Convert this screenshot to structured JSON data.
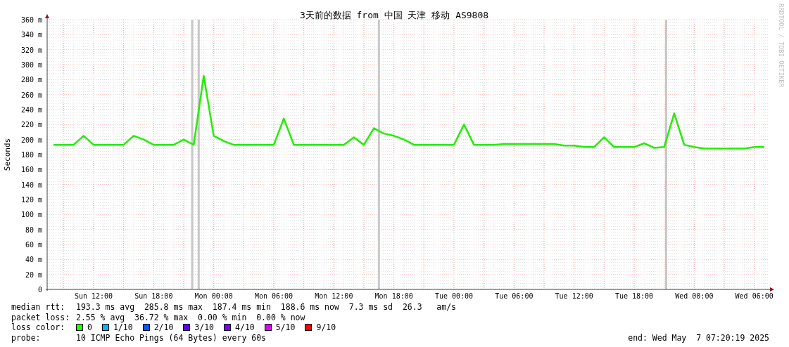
{
  "graph": {
    "credit": "RRDTOOL / TOBI OETIKER",
    "chart_data": {
      "type": "line",
      "title": "3天前的数据 from 中国 天津 移动 AS9808",
      "ylabel": "Seconds",
      "ylim": [
        0,
        360
      ],
      "categories": [
        null,
        null,
        null,
        null,
        "Sun 12:00",
        null,
        null,
        null,
        null,
        null,
        "Sun 18:00",
        null,
        null,
        null,
        null,
        null,
        "Mon 00:00",
        null,
        null,
        null,
        null,
        null,
        "Mon 06:00",
        null,
        null,
        null,
        null,
        null,
        "Mon 12:00",
        null,
        null,
        null,
        null,
        null,
        "Mon 18:00",
        null,
        null,
        null,
        null,
        null,
        "Tue 00:00",
        null,
        null,
        null,
        null,
        null,
        "Tue 06:00",
        null,
        null,
        null,
        null,
        null,
        "Tue 12:00",
        null,
        null,
        null,
        null,
        null,
        "Tue 18:00",
        null,
        null,
        null,
        null,
        null,
        "Wed 00:00",
        null,
        null,
        null,
        null,
        null,
        "Wed 06:00",
        null
      ],
      "yticks": [
        {
          "value": 0,
          "label": "0"
        },
        {
          "value": 20,
          "label": "20 m"
        },
        {
          "value": 40,
          "label": "40 m"
        },
        {
          "value": 60,
          "label": "60 m"
        },
        {
          "value": 80,
          "label": "80 m"
        },
        {
          "value": 100,
          "label": "100 m"
        },
        {
          "value": 120,
          "label": "120 m"
        },
        {
          "value": 140,
          "label": "140 m"
        },
        {
          "value": 160,
          "label": "160 m"
        },
        {
          "value": 180,
          "label": "180 m"
        },
        {
          "value": 200,
          "label": "200 m"
        },
        {
          "value": 220,
          "label": "220 m"
        },
        {
          "value": 240,
          "label": "240 m"
        },
        {
          "value": 260,
          "label": "260 m"
        },
        {
          "value": 280,
          "label": "280 m"
        },
        {
          "value": 300,
          "label": "300 m"
        },
        {
          "value": 320,
          "label": "320 m"
        },
        {
          "value": 340,
          "label": "340 m"
        },
        {
          "value": 360,
          "label": "360 m"
        }
      ],
      "series": [
        {
          "color": "#22ee00",
          "values": [
            193,
            193,
            193,
            205,
            193,
            193,
            193,
            193,
            205,
            200,
            193,
            193,
            193,
            200,
            193,
            285,
            205,
            198,
            193,
            193,
            193,
            193,
            193,
            228,
            193,
            193,
            193,
            193,
            193,
            193,
            203,
            193,
            215,
            208,
            205,
            200,
            193,
            193,
            193,
            193,
            193,
            220,
            193,
            193,
            193,
            194,
            194,
            194,
            194,
            194,
            194,
            192,
            192,
            190,
            190,
            203,
            190,
            190,
            190,
            195,
            189,
            190,
            235,
            193,
            190,
            188,
            188,
            188,
            188,
            188,
            190,
            190
          ]
        }
      ],
      "grid": true
    }
  },
  "legend": {
    "median_rtt": {
      "label": "median rtt:",
      "value": "193.3 ms avg  285.8 ms max  187.4 ms min  188.6 ms now  7.3 ms sd  26.3   am/s"
    },
    "packet_loss": {
      "label": "packet loss:",
      "value": "2.55 % avg  36.72 % max  0.00 % min  0.00 % now"
    },
    "loss_color": {
      "label": "loss color:",
      "items": [
        {
          "label": "0",
          "color": "#26ff00"
        },
        {
          "label": "1/10",
          "color": "#00b8ff"
        },
        {
          "label": "2/10",
          "color": "#0059ff"
        },
        {
          "label": "3/10",
          "color": "#5e00ff"
        },
        {
          "label": "4/10",
          "color": "#7e00ff"
        },
        {
          "label": "5/10",
          "color": "#dd00ff"
        },
        {
          "label": "9/10",
          "color": "#ff0000"
        }
      ]
    },
    "probe": {
      "label": "probe:",
      "value": "10 ICMP Echo Pings (64 Bytes) every 60s"
    },
    "end": "end: Wed May  7 07:20:19 2025"
  }
}
